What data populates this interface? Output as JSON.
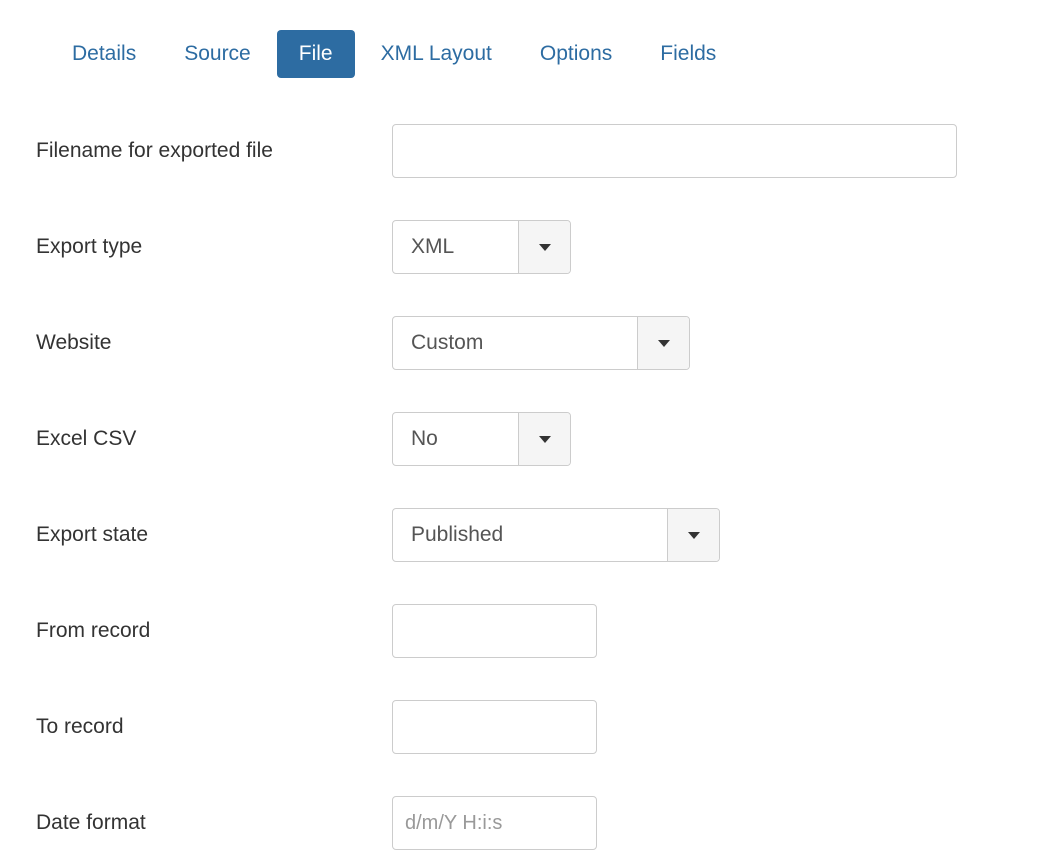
{
  "tabs": [
    {
      "label": "Details",
      "active": false
    },
    {
      "label": "Source",
      "active": false
    },
    {
      "label": "File",
      "active": true
    },
    {
      "label": "XML Layout",
      "active": false
    },
    {
      "label": "Options",
      "active": false
    },
    {
      "label": "Fields",
      "active": false
    }
  ],
  "form": {
    "filename": {
      "label": "Filename for exported file",
      "value": ""
    },
    "export_type": {
      "label": "Export type",
      "value": "XML"
    },
    "website": {
      "label": "Website",
      "value": "Custom"
    },
    "excel_csv": {
      "label": "Excel CSV",
      "value": "No"
    },
    "export_state": {
      "label": "Export state",
      "value": "Published"
    },
    "from_record": {
      "label": "From record",
      "value": ""
    },
    "to_record": {
      "label": "To record",
      "value": ""
    },
    "date_format": {
      "label": "Date format",
      "placeholder": "d/m/Y H:i:s",
      "value": ""
    }
  }
}
